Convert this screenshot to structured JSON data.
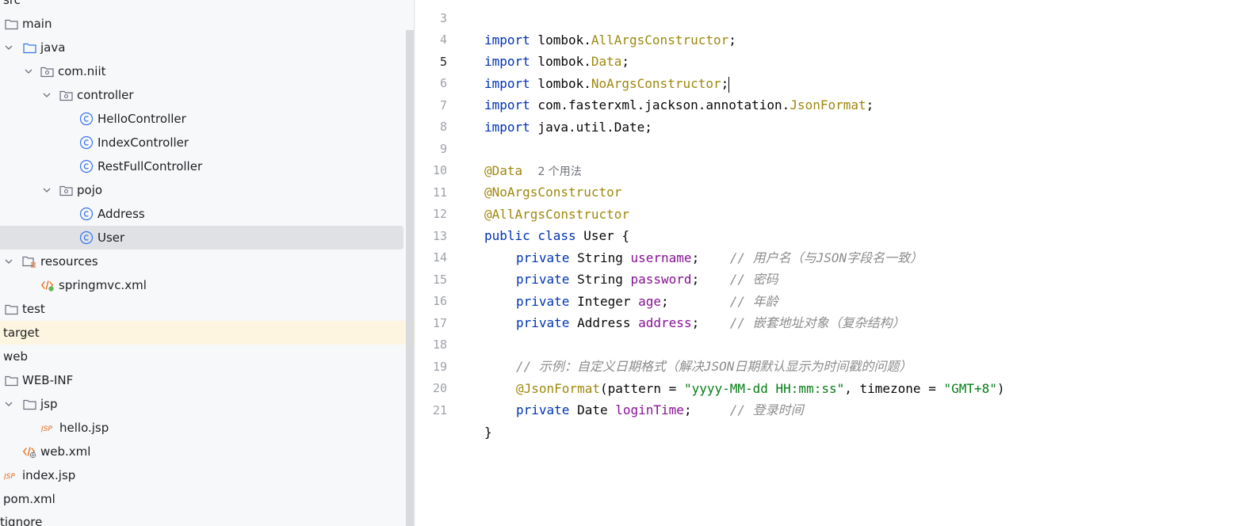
{
  "tree": {
    "items": [
      {
        "label": "src",
        "icon": "folder-icon"
      },
      {
        "label": "main",
        "icon": "folder-icon"
      },
      {
        "label": "java",
        "icon": "source-folder-icon"
      },
      {
        "label": "com.niit",
        "icon": "package-icon"
      },
      {
        "label": "controller",
        "icon": "package-icon"
      },
      {
        "label": "HelloController",
        "icon": "class-icon"
      },
      {
        "label": "IndexController",
        "icon": "class-icon"
      },
      {
        "label": "RestFullController",
        "icon": "class-icon"
      },
      {
        "label": "pojo",
        "icon": "package-icon"
      },
      {
        "label": "Address",
        "icon": "class-icon"
      },
      {
        "label": "User",
        "icon": "class-icon"
      },
      {
        "label": "resources",
        "icon": "resources-folder-icon"
      },
      {
        "label": "springmvc.xml",
        "icon": "spring-xml-icon"
      },
      {
        "label": "test",
        "icon": "folder-icon"
      },
      {
        "label": "target",
        "icon": "none"
      },
      {
        "label": "web",
        "icon": "none"
      },
      {
        "label": "WEB-INF",
        "icon": "folder-icon"
      },
      {
        "label": "jsp",
        "icon": "folder-icon"
      },
      {
        "label": "hello.jsp",
        "icon": "jsp-icon"
      },
      {
        "label": "web.xml",
        "icon": "web-xml-icon"
      },
      {
        "label": "index.jsp",
        "icon": "jsp-icon"
      },
      {
        "label": "pom.xml",
        "icon": "none"
      },
      {
        "label": "tignore",
        "icon": "none"
      }
    ]
  },
  "editor": {
    "hint": "2 个用法",
    "lines": [
      {
        "n": "3",
        "top": "import lombok.AllArgsConstructor;"
      },
      {
        "n": "4"
      },
      {
        "n": "5"
      },
      {
        "n": "6"
      },
      {
        "n": "7"
      },
      {
        "n": "8"
      },
      {
        "n": "9"
      },
      {
        "n": "10"
      },
      {
        "n": "11"
      },
      {
        "n": "12"
      },
      {
        "n": "13"
      },
      {
        "n": "14"
      },
      {
        "n": "15"
      },
      {
        "n": "16"
      },
      {
        "n": "17"
      },
      {
        "n": "18"
      },
      {
        "n": "19"
      },
      {
        "n": "20"
      },
      {
        "n": "21"
      }
    ],
    "tokens": {
      "l3_import": "import",
      "l3_rest": " lombok.",
      "l3_ann": "AllArgsConstructor",
      "l3_end": ";",
      "l4_import": "import",
      "l4_rest": " lombok.",
      "l4_ann": "Data",
      "l4_end": ";",
      "l5_import": "import",
      "l5_rest": " lombok.",
      "l5_ann": "NoArgsConstructor",
      "l5_end": ";",
      "l6_import": "import",
      "l6_rest": " com.fasterxml.jackson.annotation.",
      "l6_ann": "JsonFormat",
      "l6_end": ";",
      "l7_import": "import",
      "l7_rest": " java.util.Date;",
      "l9_ann": "@Data",
      "l10_ann": "@NoArgsConstructor",
      "l11_ann": "@AllArgsConstructor",
      "l12_kw": "public class",
      "l12_rest": " User {",
      "l13_kw": "private",
      "l13_type": " String ",
      "l13_fld": "username",
      "l13_semi": ";    ",
      "l13_cmt": "// 用户名（与JSON字段名一致）",
      "l14_kw": "private",
      "l14_type": " String ",
      "l14_fld": "password",
      "l14_semi": ";    ",
      "l14_cmt": "// 密码",
      "l15_kw": "private",
      "l15_type": " Integer ",
      "l15_fld": "age",
      "l15_semi": ";        ",
      "l15_cmt": "// 年龄",
      "l16_kw": "private",
      "l16_type": " Address ",
      "l16_fld": "address",
      "l16_semi": ";    ",
      "l16_cmt": "// 嵌套地址对象（复杂结构）",
      "l18_cmt": "// 示例：自定义日期格式（解决JSON日期默认显示为时间戳的问题）",
      "l19_ann": "@JsonFormat",
      "l19_a": "(pattern = ",
      "l19_s1": "\"yyyy-MM-dd HH:mm:ss\"",
      "l19_b": ", timezone = ",
      "l19_s2": "\"GMT+8\"",
      "l19_c": ")",
      "l20_kw": "private",
      "l20_type": " Date ",
      "l20_fld": "loginTime",
      "l20_semi": ";     ",
      "l20_cmt": "// 登录时间",
      "l21": "}"
    }
  },
  "colors": {
    "keyword": "#0033b3",
    "annotation": "#9e880d",
    "field": "#871094",
    "string": "#067d17",
    "comment": "#8c8c8c",
    "selection": "#dfe1e5",
    "target_highlight": "#fdf5e0"
  }
}
